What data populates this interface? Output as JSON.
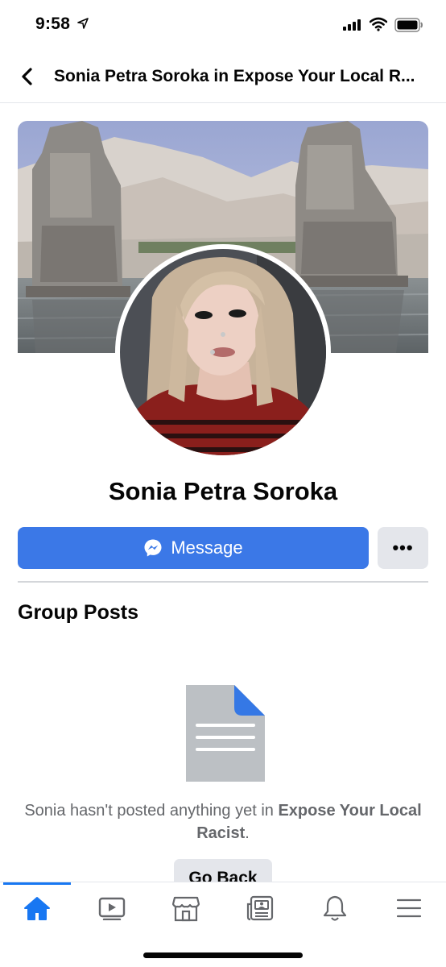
{
  "status_bar": {
    "time": "9:58",
    "icons": [
      "location-arrow-icon",
      "cellular-signal-icon",
      "wifi-icon",
      "battery-icon"
    ]
  },
  "header": {
    "back_icon": "chevron-left-icon",
    "title": "Sonia Petra Soroka in Expose Your Local R..."
  },
  "profile": {
    "name": "Sonia Petra Soroka",
    "cover_image": "cover-photo-statues",
    "avatar_image": "profile-photo"
  },
  "actions": {
    "message_label": "Message",
    "message_icon": "messenger-icon",
    "more_label": "•••"
  },
  "group_posts": {
    "title": "Group Posts",
    "empty_icon": "document-icon",
    "empty_prefix": "Sonia hasn't posted anything yet in ",
    "group_name": "Expose Your Local Racist",
    "empty_suffix": ".",
    "go_back_label": "Go Back"
  },
  "tab_bar": {
    "tabs": [
      {
        "name": "home",
        "icon": "home-icon",
        "active": true
      },
      {
        "name": "watch",
        "icon": "video-icon",
        "active": false
      },
      {
        "name": "marketplace",
        "icon": "marketplace-icon",
        "active": false
      },
      {
        "name": "news",
        "icon": "news-icon",
        "active": false
      },
      {
        "name": "notifications",
        "icon": "bell-icon",
        "active": false
      },
      {
        "name": "menu",
        "icon": "menu-icon",
        "active": false
      }
    ]
  },
  "colors": {
    "accent": "#1877f2",
    "message_button": "#3b78e7",
    "secondary_button": "#e4e6eb",
    "muted_text": "#65676b"
  }
}
